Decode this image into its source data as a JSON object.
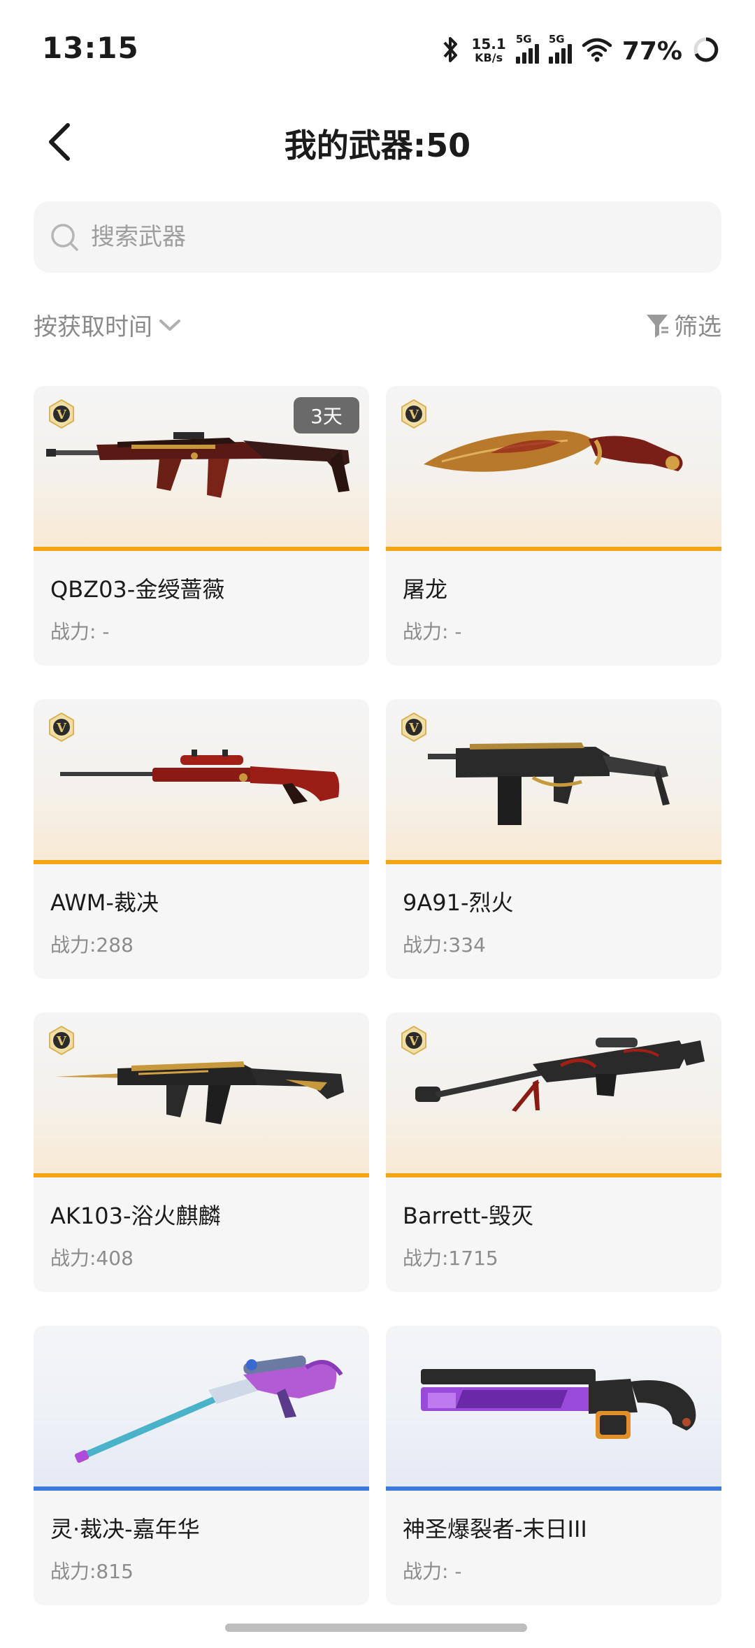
{
  "status_bar": {
    "time": "13:15",
    "speed_value": "15.1",
    "speed_unit": "KB/s",
    "signal1_label": "5G",
    "signal2_label": "5G",
    "battery": "77%"
  },
  "header": {
    "title": "我的武器:50"
  },
  "search": {
    "placeholder": "搜索武器",
    "value": ""
  },
  "sort": {
    "label": "按获取时间"
  },
  "filter": {
    "label": "筛选"
  },
  "colors": {
    "gold_accent": "#f3a412",
    "blue_accent": "#3b78db",
    "tag_bg": "#6a6a6a"
  },
  "weapons": [
    {
      "name": "QBZ03-金绶蔷薇",
      "power": "战力: -",
      "tag": "3天"
    },
    {
      "name": "屠龙",
      "power": "战力: -"
    },
    {
      "name": "AWM-裁决",
      "power": "战力:288"
    },
    {
      "name": "9A91-烈火",
      "power": "战力:334"
    },
    {
      "name": "AK103-浴火麒麟",
      "power": "战力:408"
    },
    {
      "name": "Barrett-毁灭",
      "power": "战力:1715"
    },
    {
      "name": "灵·裁决-嘉年华",
      "power": "战力:815"
    },
    {
      "name": "神圣爆裂者-末日III",
      "power": "战力: -"
    }
  ]
}
